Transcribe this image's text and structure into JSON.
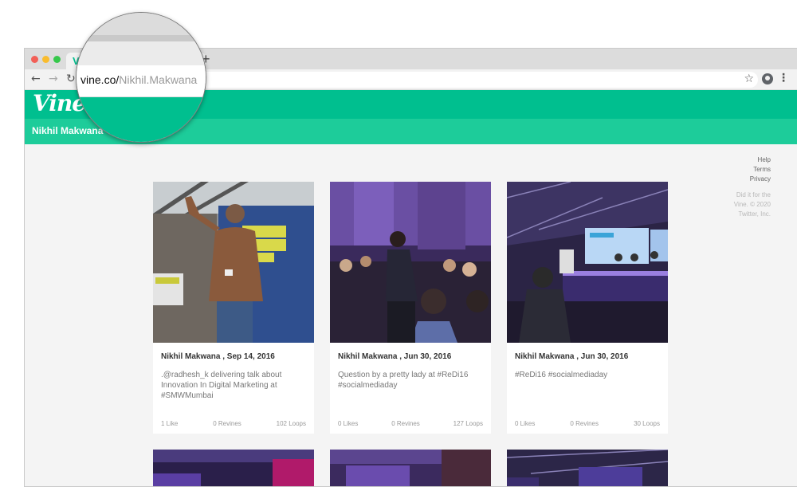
{
  "browser": {
    "url_domain": "vine.co/",
    "url_path": "Nikhil.Makwana",
    "new_tab": "+",
    "tab_favicon": "V",
    "icons": [
      "back-icon",
      "forward-icon",
      "reload-icon",
      "star-icon",
      "profile-icon",
      "menu-icon"
    ]
  },
  "site": {
    "logo": "Vine",
    "profile_name": "Nikhil Makwana",
    "brand_color": "#00bf8f",
    "footer": {
      "help": "Help",
      "terms": "Terms",
      "privacy": "Privacy",
      "note": "Did it for the Vine. © 2020 Twitter, Inc."
    }
  },
  "posts": [
    {
      "author": "Nikhil Makwana",
      "date": " , Sep 14, 2016",
      "description": ".@radhesh_k delivering talk about Innovation In Digital Marketing at #SMWMumbai",
      "likes": "1 Like",
      "revines": "0 Revines",
      "loops": "102 Loops"
    },
    {
      "author": "Nikhil Makwana",
      "date": " , Jun 30, 2016",
      "description": "Question by a pretty lady at #ReDi16 #socialmediaday",
      "likes": "0 Likes",
      "revines": "0 Revines",
      "loops": "127 Loops"
    },
    {
      "author": "Nikhil Makwana",
      "date": " , Jun 30, 2016",
      "description": "#ReDi16 #socialmediaday",
      "likes": "0 Likes",
      "revines": "0 Revines",
      "loops": "30 Loops"
    }
  ]
}
